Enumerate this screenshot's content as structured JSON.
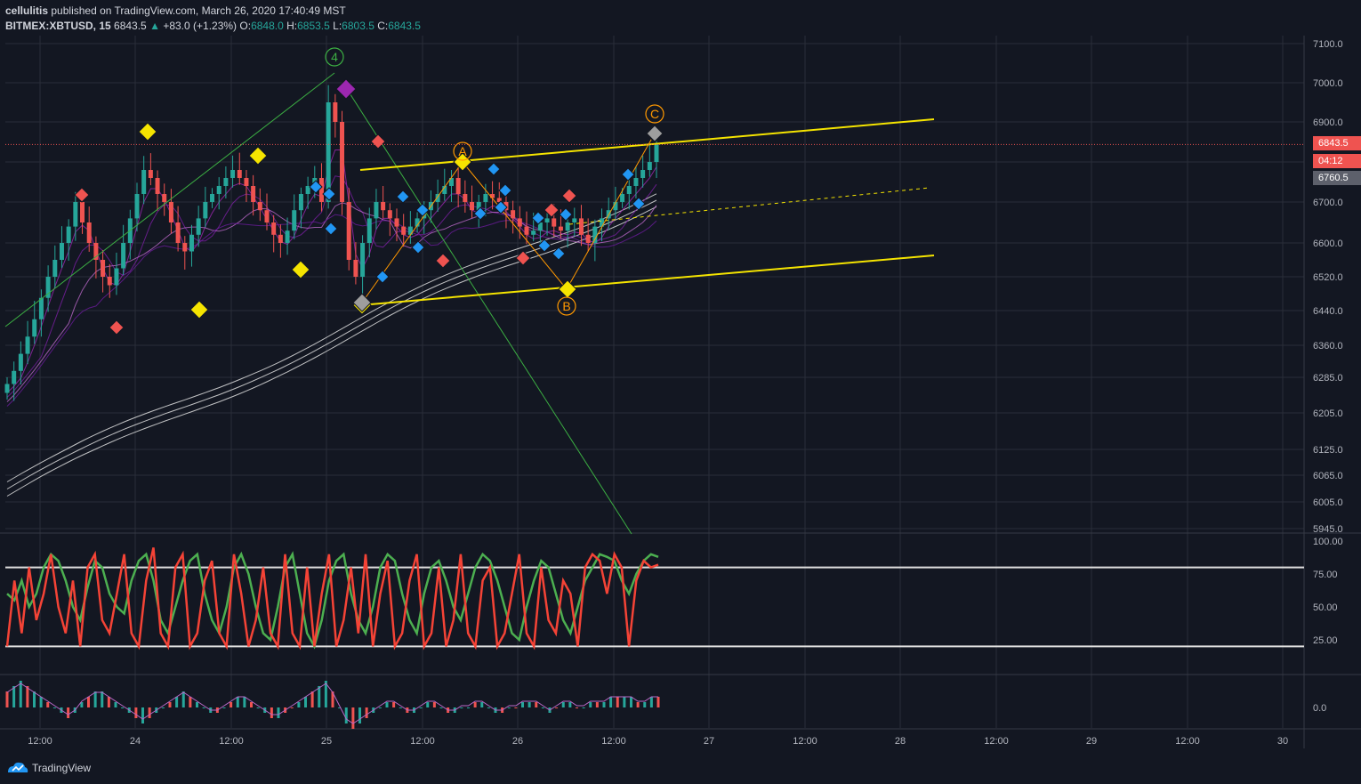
{
  "header": {
    "publisher": "cellulitis",
    "published_text": "published on TradingView.com, March 26, 2020 17:40:49 MST",
    "symbol": "BITMEX:XBTUSD, 15",
    "last_price": "6843.5",
    "change": "+83.0 (+1.23%)",
    "open_label": "O:",
    "open": "6848.0",
    "high_label": "H:",
    "high": "6853.5",
    "low_label": "L:",
    "low": "6803.5",
    "close_label": "C:",
    "close": "6843.5"
  },
  "price_tags": {
    "last": "6843.5",
    "countdown": "04:12",
    "ma": "6760.5"
  },
  "footer": {
    "brand": "TradingView"
  },
  "colors": {
    "background": "#131722",
    "grid": "#2a2e39",
    "up": "#26a69a",
    "down": "#ef5350",
    "yellow": "#f5e400",
    "wave_green": "#3cb043",
    "stoch_k": "#4caf50",
    "stoch_d": "#f44336",
    "last_price_tag": "#ef5350",
    "ma_tag": "#5d606b"
  },
  "chart_data": [
    {
      "type": "line",
      "title": "",
      "series_kind": "candlestick",
      "y_ticks": [
        "7100.0",
        "7000.0",
        "6900.0",
        "6800.0",
        "6700.0",
        "6600.0",
        "6520.0",
        "6440.0",
        "6360.0",
        "6285.0",
        "6205.0",
        "6125.0",
        "6065.0",
        "6005.0",
        "5945.0"
      ],
      "x_ticks": [
        "12:00",
        "24",
        "12:00",
        "25",
        "12:00",
        "26",
        "12:00",
        "27",
        "12:00",
        "28",
        "12:00",
        "29",
        "12:00",
        "30"
      ],
      "ylim": [
        5945,
        7100
      ],
      "close_series": [
        6270,
        6300,
        6340,
        6380,
        6420,
        6470,
        6520,
        6560,
        6600,
        6640,
        6700,
        6650,
        6600,
        6560,
        6520,
        6500,
        6540,
        6600,
        6660,
        6720,
        6780,
        6760,
        6720,
        6700,
        6650,
        6600,
        6580,
        6620,
        6660,
        6700,
        6720,
        6740,
        6760,
        6780,
        6760,
        6740,
        6700,
        6680,
        6650,
        6620,
        6600,
        6630,
        6680,
        6720,
        6740,
        6760,
        6700,
        6950,
        6900,
        6700,
        6560,
        6520,
        6600,
        6660,
        6700,
        6680,
        6660,
        6640,
        6620,
        6640,
        6660,
        6680,
        6700,
        6720,
        6740,
        6760,
        6720,
        6700,
        6680,
        6700,
        6720,
        6710,
        6700,
        6680,
        6660,
        6640,
        6620,
        6630,
        6650,
        6660,
        6640,
        6630,
        6650,
        6660,
        6620,
        6600,
        6640,
        6660,
        6680,
        6700,
        6720,
        6740,
        6760,
        6780,
        6800,
        6843.5
      ],
      "last": 6843.5,
      "annotations": [
        "4",
        "A",
        "B",
        "C"
      ]
    },
    {
      "type": "line",
      "title": "",
      "y_ticks": [
        "100.00",
        "75.00",
        "50.00",
        "25.00"
      ],
      "ylim": [
        0,
        100
      ],
      "bands": [
        80,
        20
      ],
      "series": [
        {
          "color": "#4caf50",
          "values": [
            60,
            55,
            70,
            50,
            60,
            80,
            90,
            85,
            70,
            50,
            40,
            65,
            85,
            80,
            60,
            50,
            45,
            70,
            85,
            90,
            70,
            40,
            30,
            50,
            70,
            85,
            90,
            60,
            40,
            30,
            50,
            80,
            90,
            75,
            50,
            30,
            25,
            50,
            80,
            90,
            60,
            30,
            20,
            40,
            70,
            85,
            90,
            60,
            40,
            30,
            50,
            80,
            90,
            85,
            60,
            40,
            30,
            60,
            80,
            85,
            70,
            50,
            40,
            60,
            80,
            90,
            85,
            70,
            50,
            30,
            25,
            50,
            70,
            85,
            80,
            60,
            40,
            30,
            50,
            70,
            80,
            90,
            88,
            85,
            70,
            60,
            75,
            85,
            90,
            88
          ]
        },
        {
          "color": "#f44336",
          "values": [
            20,
            70,
            30,
            80,
            40,
            60,
            90,
            50,
            30,
            70,
            20,
            80,
            90,
            40,
            30,
            60,
            90,
            30,
            20,
            70,
            95,
            30,
            20,
            80,
            90,
            20,
            30,
            70,
            85,
            30,
            20,
            90,
            60,
            20,
            40,
            80,
            30,
            20,
            90,
            30,
            20,
            80,
            20,
            60,
            90,
            20,
            40,
            80,
            30,
            90,
            20,
            60,
            85,
            20,
            30,
            70,
            90,
            20,
            30,
            80,
            20,
            40,
            90,
            30,
            20,
            70,
            80,
            20,
            30,
            60,
            90,
            30,
            20,
            80,
            40,
            30,
            70,
            60,
            20,
            80,
            90,
            85,
            60,
            90,
            80,
            20,
            70,
            85,
            80,
            82
          ]
        }
      ]
    },
    {
      "type": "bar",
      "title": "",
      "y_ticks": [
        "0.0"
      ],
      "values": [
        3,
        4,
        5,
        4,
        3,
        2,
        1,
        0,
        -1,
        -2,
        -1,
        1,
        2,
        3,
        3,
        2,
        1,
        0,
        -1,
        -2,
        -3,
        -2,
        -1,
        0,
        1,
        2,
        3,
        2,
        1,
        0,
        -1,
        -1,
        0,
        1,
        2,
        2,
        1,
        0,
        -1,
        -2,
        -2,
        -1,
        0,
        1,
        2,
        3,
        4,
        5,
        3,
        0,
        -3,
        -4,
        -3,
        -2,
        -1,
        0,
        1,
        1,
        0,
        -1,
        -1,
        0,
        1,
        1,
        0,
        -1,
        -1,
        0,
        0,
        1,
        1,
        0,
        -1,
        -1,
        0,
        0,
        1,
        1,
        1,
        0,
        -1,
        0,
        1,
        1,
        0,
        0,
        1,
        1,
        1,
        2,
        2,
        2,
        2,
        1,
        1,
        2,
        2
      ]
    }
  ]
}
